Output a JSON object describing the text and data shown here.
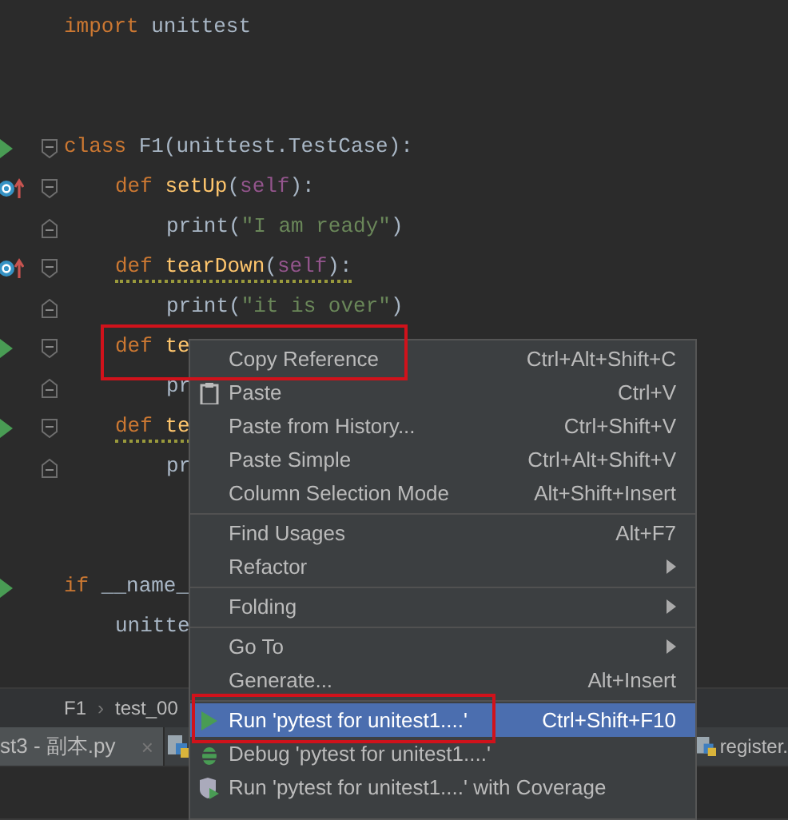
{
  "editor": {
    "lines": [
      {
        "kind": "code",
        "run_marker": false,
        "override_marker": false,
        "fold_start": false,
        "fold_end": false,
        "warning": false,
        "tokens": [
          {
            "text": "import",
            "kind": "keyword"
          },
          {
            "text": " unittest",
            "kind": "plain"
          }
        ]
      },
      {
        "kind": "blank"
      },
      {
        "kind": "blank"
      },
      {
        "kind": "code",
        "run_marker": true,
        "override_marker": false,
        "fold_start": true,
        "fold_end": false,
        "warning": false,
        "tokens": [
          {
            "text": "class",
            "kind": "keyword"
          },
          {
            "text": " F1(unittest.TestCase):",
            "kind": "plain"
          }
        ],
        "children": [
          {
            "kind": "code",
            "run_marker": false,
            "override_marker": true,
            "fold_start": true,
            "fold_end": false,
            "warning": false,
            "tokens": [
              {
                "text": "def",
                "kind": "keyword"
              },
              {
                "text": " setUp",
                "kind": "function"
              },
              {
                "text": "(",
                "kind": "plain"
              },
              {
                "text": "self",
                "kind": "self"
              },
              {
                "text": "):",
                "kind": "plain"
              }
            ],
            "children": [
              {
                "kind": "code",
                "run_marker": false,
                "override_marker": false,
                "fold_start": false,
                "fold_end": true,
                "warning": false,
                "tokens": [
                  {
                    "text": "print(",
                    "kind": "plain"
                  },
                  {
                    "text": "\"I am ready\"",
                    "kind": "string"
                  },
                  {
                    "text": ")",
                    "kind": "plain"
                  }
                ]
              }
            ]
          },
          {
            "kind": "code",
            "run_marker": false,
            "override_marker": true,
            "fold_start": true,
            "fold_end": false,
            "warning": true,
            "tokens": [
              {
                "text": "def",
                "kind": "keyword"
              },
              {
                "text": " tearDown",
                "kind": "function"
              },
              {
                "text": "(",
                "kind": "plain"
              },
              {
                "text": "self",
                "kind": "self"
              },
              {
                "text": "):",
                "kind": "plain"
              }
            ],
            "children": [
              {
                "kind": "code",
                "run_marker": false,
                "override_marker": false,
                "fold_start": false,
                "fold_end": true,
                "warning": false,
                "tokens": [
                  {
                    "text": "print(",
                    "kind": "plain"
                  },
                  {
                    "text": "\"it is over\"",
                    "kind": "string"
                  },
                  {
                    "text": ")",
                    "kind": "plain"
                  }
                ]
              }
            ]
          },
          {
            "kind": "code",
            "run_marker": true,
            "override_marker": false,
            "fold_start": true,
            "fold_end": false,
            "warning": false,
            "tokens": [
              {
                "text": "def",
                "kind": "keyword"
              },
              {
                "text": " te",
                "kind": "function"
              }
            ],
            "children": [
              {
                "kind": "code",
                "run_marker": false,
                "override_marker": false,
                "fold_start": false,
                "fold_end": true,
                "warning": false,
                "tokens": [
                  {
                    "text": "pr",
                    "kind": "plain"
                  }
                ]
              }
            ]
          },
          {
            "kind": "code",
            "run_marker": true,
            "override_marker": false,
            "fold_start": true,
            "fold_end": false,
            "warning": true,
            "tokens": [
              {
                "text": "def",
                "kind": "keyword"
              },
              {
                "text": " te",
                "kind": "function"
              }
            ],
            "children": [
              {
                "kind": "code",
                "run_marker": false,
                "override_marker": false,
                "fold_start": false,
                "fold_end": true,
                "warning": false,
                "tokens": [
                  {
                    "text": "pr",
                    "kind": "plain"
                  }
                ]
              }
            ]
          }
        ]
      },
      {
        "kind": "blank"
      },
      {
        "kind": "blank"
      },
      {
        "kind": "code",
        "run_marker": true,
        "override_marker": false,
        "fold_start": false,
        "fold_end": false,
        "warning": false,
        "tokens": [
          {
            "text": "if",
            "kind": "keyword"
          },
          {
            "text": " __name_",
            "kind": "plain"
          }
        ],
        "children": [
          {
            "kind": "code",
            "run_marker": false,
            "override_marker": false,
            "fold_start": false,
            "fold_end": false,
            "warning": false,
            "tokens": [
              {
                "text": "unitte",
                "kind": "plain"
              }
            ]
          }
        ]
      }
    ]
  },
  "breadcrumb": {
    "items": [
      "F1",
      "test_00"
    ],
    "separator": "›"
  },
  "tabs": [
    {
      "label": "st3 - 副本.py",
      "close": "×",
      "kind": "file",
      "selected": true
    },
    {
      "kind": "icon",
      "selected": false
    },
    {
      "label": "register.",
      "kind": "file",
      "selected": false
    }
  ],
  "context_menu": {
    "items": [
      {
        "kind": "command",
        "label": "Copy Reference",
        "shortcut": "Ctrl+Alt+Shift+C",
        "submenu": false,
        "selected": false
      },
      {
        "kind": "paste",
        "label": "Paste",
        "shortcut": "Ctrl+V",
        "submenu": false,
        "selected": false
      },
      {
        "kind": "command",
        "label": "Paste from History...",
        "shortcut": "Ctrl+Shift+V",
        "submenu": false,
        "selected": false
      },
      {
        "kind": "command",
        "label": "Paste Simple",
        "shortcut": "Ctrl+Alt+Shift+V",
        "submenu": false,
        "selected": false
      },
      {
        "kind": "command",
        "label": "Column Selection Mode",
        "shortcut": "Alt+Shift+Insert",
        "submenu": false,
        "selected": false
      },
      {
        "kind": "separator"
      },
      {
        "kind": "command",
        "label": "Find Usages",
        "shortcut": "Alt+F7",
        "submenu": false,
        "selected": false
      },
      {
        "kind": "command",
        "label": "Refactor",
        "submenu": true,
        "selected": false
      },
      {
        "kind": "separator"
      },
      {
        "kind": "command",
        "label": "Folding",
        "submenu": true,
        "selected": false
      },
      {
        "kind": "separator"
      },
      {
        "kind": "command",
        "label": "Go To",
        "submenu": true,
        "selected": false
      },
      {
        "kind": "command",
        "label": "Generate...",
        "shortcut": "Alt+Insert",
        "submenu": false,
        "selected": false
      },
      {
        "kind": "separator"
      },
      {
        "kind": "run",
        "label": "Run 'pytest for unitest1....'",
        "shortcut": "Ctrl+Shift+F10",
        "submenu": false,
        "selected": true
      },
      {
        "kind": "debug",
        "label": "Debug 'pytest for unitest1....'",
        "submenu": false,
        "selected": false
      },
      {
        "kind": "coverage",
        "label": "Run 'pytest for unitest1....' with Coverage",
        "submenu": false,
        "selected": false
      }
    ]
  }
}
